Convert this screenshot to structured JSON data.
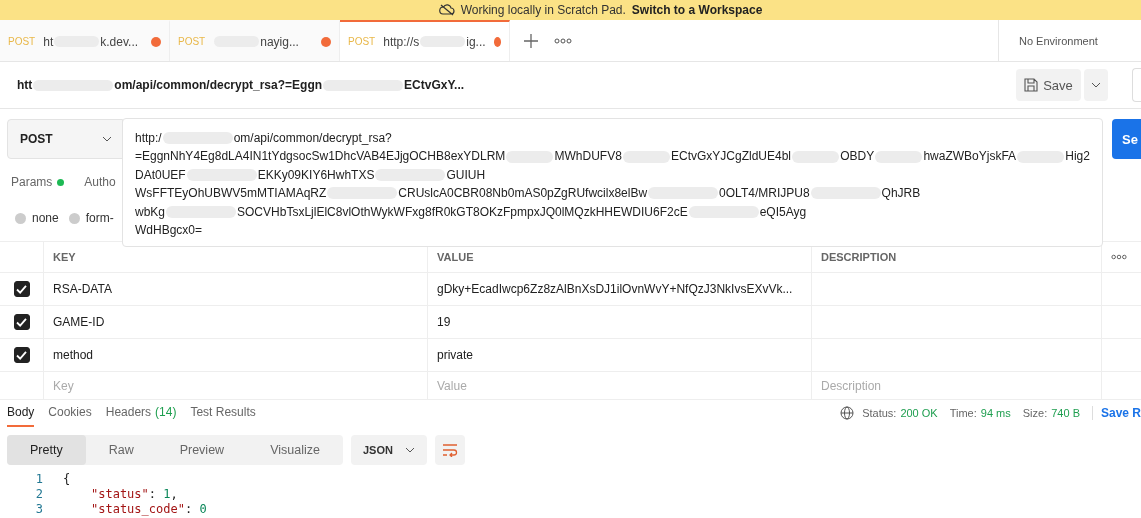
{
  "banner": {
    "text": "Working locally in Scratch Pad.",
    "link": "Switch to a Workspace"
  },
  "tabs": [
    {
      "method": "POST",
      "label": [
        "ht",
        "k.dev..."
      ],
      "unsaved": true,
      "selected": false
    },
    {
      "method": "POST",
      "leading_redaction": true,
      "label": [
        "nayig..."
      ],
      "unsaved": true,
      "selected": false
    },
    {
      "method": "POST",
      "label": [
        "http://s",
        "ig..."
      ],
      "unsaved": true,
      "selected": true
    }
  ],
  "environment": "No Environment",
  "request_title": [
    "htt",
    "om/api/common/decrypt_rsa?=Eggn",
    "ECtvGxY..."
  ],
  "save_button": "Save",
  "method": "POST",
  "url_lines": [
    [
      "http:/",
      "om/api/common/decrypt_rsa?"
    ],
    [
      "=EggnNhY4Eg8dLA4IN1tYdgsocSw1DhcVAB4EJjgOCHB8exYDLRM",
      "MWhDUFV8",
      "ECtvGxYJCgZldUE4bl",
      "OBDY",
      "hwaZWBoYjskFA",
      "Hig2"
    ],
    [
      "DAt0UEF",
      "EKKy09KIY6HwhTXS",
      "GUIUH"
    ],
    [
      "WsFFTEyOhUBWV5mMTIAMAqRZ",
      "CRUslcA0CBR08Nb0mAS0pZgRUfwcilx8elBw",
      "0OLT4/MRIJPU8",
      "QhJRB"
    ],
    [
      "wbKg",
      "SOCVHbTsxLjlElC8vlOthWykWFxg8fR0kGT8OKzFpmpxJQ0lMQzkHHEWDIU6F2cE",
      "eQI5Ayg"
    ],
    [
      "WdHBgcx0="
    ]
  ],
  "send_button": "Se",
  "request_tabs": [
    {
      "label": "Params",
      "indicator": true
    },
    {
      "label": "Autho"
    }
  ],
  "body_types": [
    {
      "label": "none",
      "selected": false
    },
    {
      "label": "form-",
      "selected": false
    }
  ],
  "params": {
    "columns": [
      "KEY",
      "VALUE",
      "DESCRIPTION"
    ],
    "rows": [
      {
        "checked": true,
        "key": "RSA-DATA",
        "value": "gDky+EcadIwcp6Zz8zAlBnXsDJ1ilOvnWvY+NfQzJ3NkIvsEXvVk..."
      },
      {
        "checked": true,
        "key": "GAME-ID",
        "value": "19"
      },
      {
        "checked": true,
        "key": "method",
        "value": "private"
      }
    ],
    "new_row": [
      {
        "placeholder": "Key"
      },
      {
        "placeholder": "Value"
      },
      {
        "placeholder": "Description"
      }
    ]
  },
  "response_tabs": [
    {
      "label": "Body",
      "selected": true
    },
    {
      "label": "Cookies",
      "selected": false
    },
    {
      "label": "Headers",
      "count": "(14)",
      "selected": false
    },
    {
      "label": "Test Results",
      "selected": false
    }
  ],
  "response_meta": {
    "status_label": "Status:",
    "status": "200 OK",
    "time_label": "Time:",
    "time": "94 ms",
    "size_label": "Size:",
    "size": "740 B",
    "save": "Save R"
  },
  "view_modes": [
    {
      "label": "Pretty",
      "selected": true
    },
    {
      "label": "Raw",
      "selected": false
    },
    {
      "label": "Preview",
      "selected": false
    },
    {
      "label": "Visualize",
      "selected": false
    }
  ],
  "format": "JSON",
  "code_lines": [
    {
      "number": "1",
      "tokens": [
        {
          "kind": "punct",
          "text": "{"
        }
      ]
    },
    {
      "number": "2",
      "tokens": [
        {
          "kind": "key",
          "text": "\"status\""
        },
        {
          "kind": "punct",
          "text": ": "
        },
        {
          "kind": "number",
          "text": "1"
        },
        {
          "kind": "punct",
          "text": ","
        }
      ]
    },
    {
      "number": "3",
      "tokens": [
        {
          "kind": "key",
          "text": "\"status_code\""
        },
        {
          "kind": "punct",
          "text": ": "
        },
        {
          "kind": "number",
          "text": "0"
        }
      ]
    }
  ]
}
